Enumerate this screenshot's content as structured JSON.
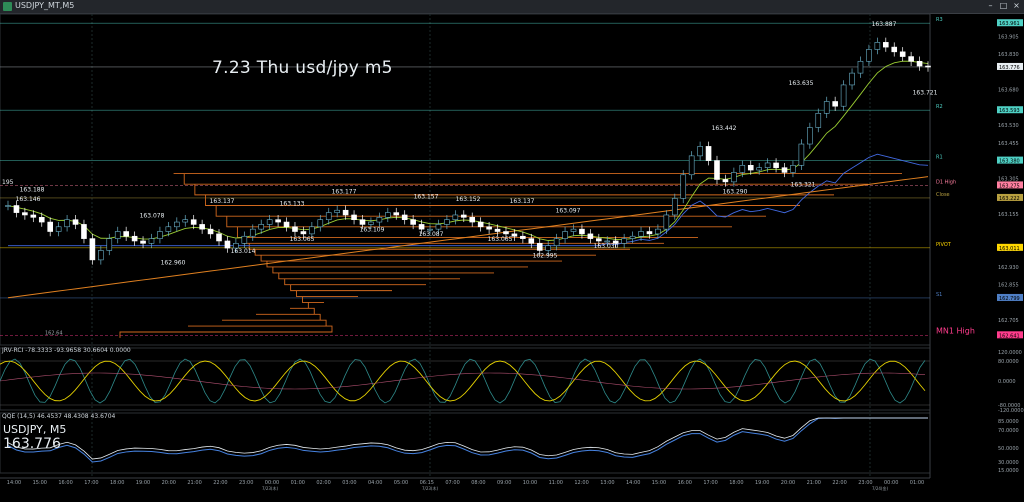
{
  "window": {
    "title": "USDJPY_MT,M5",
    "minimize": "–",
    "restore": "□",
    "close": "×"
  },
  "annotation": "7.23 Thu usd/jpy m5",
  "symbol_label": "USDJPY, M5",
  "big_price": "163.776",
  "indicators": {
    "ind1_caption": "JRV-RCI -78.3333 -93.9658 30.6604 0.0000",
    "ind2_caption": "QQE (14,5) 46.4537 48.4308 43.6704"
  },
  "levels": [
    {
      "name": "R3",
      "price": 163.961,
      "label": "163.961",
      "color": "#4fd1c5"
    },
    {
      "name": "R2",
      "price": 163.593,
      "label": "163.593",
      "color": "#4fd1c5"
    },
    {
      "name": "R1",
      "price": 163.38,
      "label": "163.380",
      "color": "#4fd1c5"
    },
    {
      "name": "D1 High",
      "price": 163.275,
      "label": "163.275",
      "color": "#ff7fa0"
    },
    {
      "name": "Close",
      "price": 163.222,
      "label": "163.222",
      "color": "#b8a040"
    },
    {
      "name": "PIVOT",
      "price": 163.011,
      "label": "163.011",
      "color": "#ffd700"
    },
    {
      "name": "S1",
      "price": 162.799,
      "label": "162.799",
      "color": "#4f7fc5"
    },
    {
      "name": "MN1 High",
      "price": 162.641,
      "label": "162.641",
      "color": "#ff3c8c"
    }
  ],
  "current_price": {
    "label": "163.776",
    "price": 163.776
  },
  "peak_labels": [
    "163.188",
    "163.146",
    "163.078",
    "163.137",
    "163.133",
    "163.177",
    "163.157",
    "163.152",
    "163.137",
    "163.097",
    "163.442",
    "163.635",
    "163.887",
    "163.721",
    "163.290",
    "163.321"
  ],
  "trough_labels": [
    "162.960",
    "163.014",
    "163.065",
    "163.109",
    "163.087",
    "163.065",
    "162.995",
    "163.030"
  ],
  "left_labels": [
    "195",
    "162.64"
  ],
  "price_axis_ticks": [
    "163.905",
    "163.830",
    "163.680",
    "163.530",
    "163.455",
    "163.305",
    "163.155",
    "163.005",
    "162.930",
    "162.855",
    "162.705"
  ],
  "ind1_axis": [
    "120.0000",
    "80.0000",
    "0.0000",
    "-80.0000",
    "-120.0000"
  ],
  "ind2_axis": [
    "85.0000",
    "70.0000",
    "50.0000",
    "30.0000",
    "15.0000"
  ],
  "time_axis": [
    "14:00",
    "15:00",
    "16:00",
    "17:00",
    "18:00",
    "19:00",
    "20:00",
    "21:00",
    "22:00",
    "23:00",
    "00:00",
    "01:00",
    "02:00",
    "03:00",
    "04:00",
    "05:00",
    "06:15",
    "07:00",
    "08:00",
    "09:00",
    "10:00",
    "11:00",
    "12:00",
    "13:00",
    "14:00",
    "15:00",
    "16:00",
    "17:00",
    "18:00",
    "19:00",
    "20:00",
    "21:00",
    "22:00",
    "23:00",
    "00:00",
    "01:00"
  ],
  "date_marks": [
    "7/23(木)",
    "7/23(木)",
    "7/24(金)"
  ],
  "chart_data": {
    "type": "candlestick",
    "title": "7.23 Thu usd/jpy m5",
    "symbol": "USDJPY",
    "timeframe": "M5",
    "ylim": [
      162.6,
      164.0
    ],
    "close_series": [
      163.19,
      163.16,
      163.15,
      163.14,
      163.12,
      163.08,
      163.1,
      163.13,
      163.11,
      163.05,
      162.96,
      163.0,
      163.05,
      163.08,
      163.06,
      163.04,
      163.03,
      163.05,
      163.08,
      163.1,
      163.12,
      163.13,
      163.11,
      163.09,
      163.07,
      163.04,
      163.01,
      163.03,
      163.06,
      163.09,
      163.11,
      163.13,
      163.12,
      163.1,
      163.08,
      163.07,
      163.1,
      163.13,
      163.16,
      163.17,
      163.15,
      163.13,
      163.11,
      163.12,
      163.14,
      163.16,
      163.15,
      163.13,
      163.11,
      163.09,
      163.09,
      163.11,
      163.13,
      163.15,
      163.14,
      163.12,
      163.1,
      163.09,
      163.08,
      163.07,
      163.06,
      163.05,
      163.03,
      163.0,
      163.02,
      163.05,
      163.08,
      163.09,
      163.07,
      163.05,
      163.04,
      163.04,
      163.03,
      163.05,
      163.06,
      163.08,
      163.07,
      163.09,
      163.15,
      163.22,
      163.32,
      163.4,
      163.44,
      163.38,
      163.3,
      163.29,
      163.33,
      163.36,
      163.34,
      163.35,
      163.37,
      163.35,
      163.33,
      163.36,
      163.45,
      163.52,
      163.58,
      163.63,
      163.61,
      163.7,
      163.75,
      163.8,
      163.85,
      163.88,
      163.86,
      163.84,
      163.82,
      163.8,
      163.78,
      163.776
    ]
  }
}
